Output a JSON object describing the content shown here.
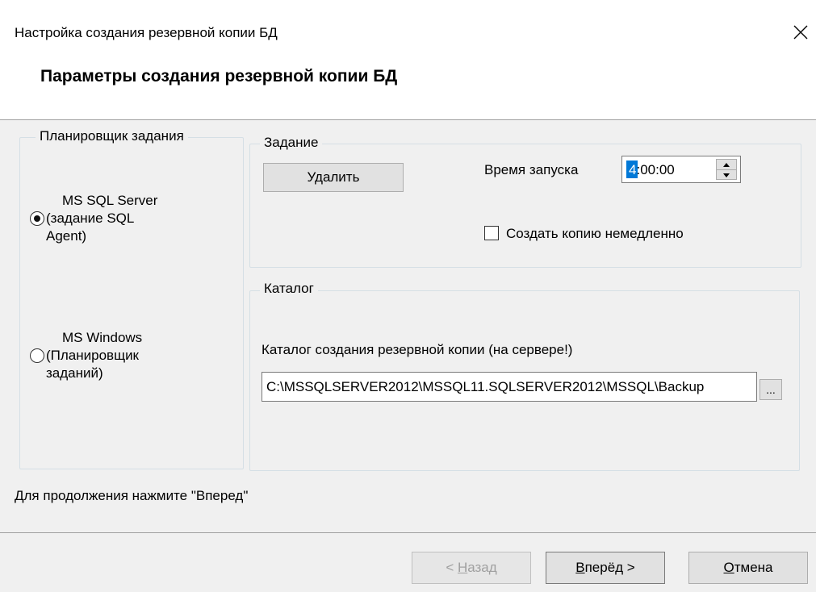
{
  "window": {
    "title": "Настройка создания резервной копии БД",
    "header": "Параметры создания резервной копии БД"
  },
  "scheduler": {
    "legend": "Планировщик задания",
    "options": [
      {
        "label_lines": [
          "MS SQL Server",
          "(задание SQL",
          "Agent)"
        ],
        "selected": true
      },
      {
        "label_lines": [
          "MS Windows",
          "(Планировщик",
          "заданий)"
        ],
        "selected": false
      }
    ]
  },
  "task": {
    "legend": "Задание",
    "delete_label": "Удалить",
    "start_time_label": "Время запуска",
    "start_time_hour": "4",
    "start_time_rest": ":00:00",
    "create_now_label": "Создать копию немедленно",
    "create_now_checked": false
  },
  "catalog": {
    "legend": "Каталог",
    "field_label": "Каталог создания резервной копии (на сервере!)",
    "path_value": "C:\\MSSQLSERVER2012\\MSSQL11.SQLSERVER2012\\MSSQL\\Backup",
    "browse_label": "..."
  },
  "hint": "Для продолжения нажмите \"Вперед\"",
  "footer": {
    "back_prefix": "< ",
    "back_key": "Н",
    "back_rest": "азад",
    "next_key": "В",
    "next_rest": "перёд >",
    "cancel_key": "О",
    "cancel_rest": "тмена"
  }
}
